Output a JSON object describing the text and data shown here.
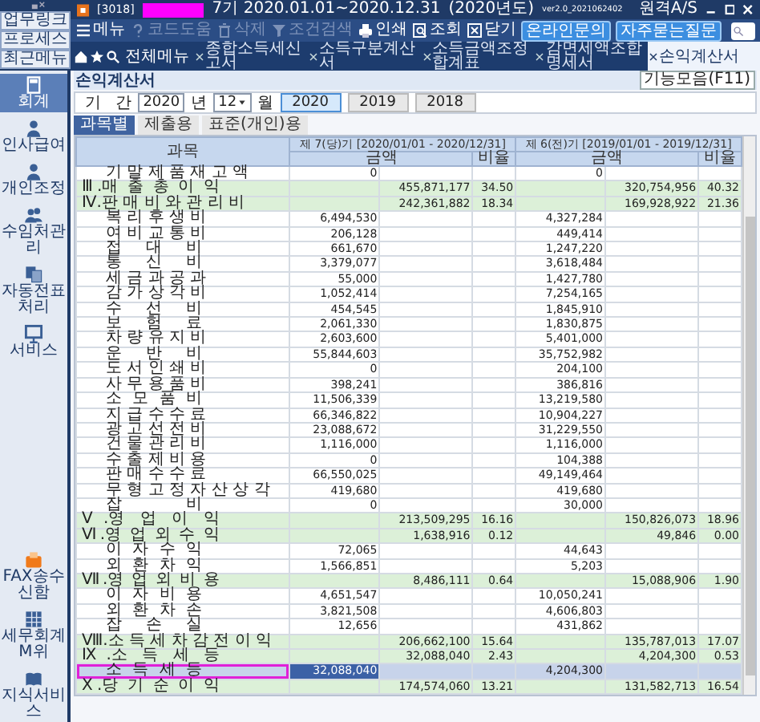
{
  "title_bar": {
    "company_code": "[3018]",
    "period": "7기 2020.01.01~2020.12.31",
    "fiscal_year": "(2020년도)",
    "version": "ver2.0_2021062402",
    "remote_support": "원격A/S"
  },
  "quick_links": [
    {
      "label": "업무링크"
    },
    {
      "label": "프로세스"
    },
    {
      "label": "최근메뉴"
    }
  ],
  "toolbar": [
    {
      "kind": "menu",
      "label": "메뉴",
      "disabled": false
    },
    {
      "kind": "help",
      "label": "코드도움",
      "disabled": true
    },
    {
      "kind": "delete",
      "label": "삭제",
      "disabled": true
    },
    {
      "kind": "filter",
      "label": "조건검색",
      "disabled": true
    },
    {
      "kind": "print",
      "label": "인쇄",
      "disabled": false
    },
    {
      "kind": "search",
      "label": "조회",
      "disabled": false
    },
    {
      "kind": "close",
      "label": "닫기",
      "disabled": false
    },
    {
      "kind": "pill",
      "label": "온라인문의",
      "disabled": false
    },
    {
      "kind": "pill",
      "label": "자주묻는질문",
      "disabled": false
    }
  ],
  "nav_tabs": {
    "all_menu": "전체메뉴",
    "tabs": [
      {
        "label": "종합소득세신고서",
        "selected": false
      },
      {
        "label": "소득구분계산서",
        "selected": false
      },
      {
        "label": "소득금액조정합계표",
        "selected": false
      },
      {
        "label": "감면세액조합명세서",
        "selected": false
      },
      {
        "label": "손익계산서",
        "selected": true
      }
    ]
  },
  "sidebar": {
    "items": [
      {
        "kind": "calculator",
        "label": "회계",
        "selected": true
      },
      {
        "kind": "person",
        "label": "인사급여",
        "selected": false
      },
      {
        "kind": "person",
        "label": "개인조정",
        "selected": false
      },
      {
        "kind": "people",
        "label": "수임처관리",
        "selected": false
      },
      {
        "kind": "docs",
        "label": "자동전표처리",
        "selected": false
      },
      {
        "kind": "monitor",
        "label": "서비스",
        "selected": false
      }
    ],
    "bottom_items": [
      {
        "kind": "fax",
        "label": "FAX송수신함"
      },
      {
        "kind": "grid",
        "label": "세무회계M위"
      },
      {
        "kind": "book",
        "label": "지식서비스"
      }
    ]
  },
  "page": {
    "title": "손익계산서",
    "functions_button": "기능모음(F11)"
  },
  "period": {
    "label": "기 간",
    "year": "2020",
    "year_unit": "년",
    "month": "12",
    "month_unit": "월",
    "year_buttons": [
      {
        "label": "2020",
        "selected": true
      },
      {
        "label": "2019",
        "selected": false
      },
      {
        "label": "2018",
        "selected": false
      }
    ]
  },
  "view_tabs": [
    {
      "label": "과목별",
      "selected": true
    },
    {
      "label": "제출용",
      "selected": false
    },
    {
      "label": "표준(개인)용",
      "selected": false
    }
  ],
  "table": {
    "subject_header": "과목",
    "current_header": "제 7(당)기 [2020/01/01 - 2020/12/31]",
    "previous_header": "제 6(전)기 [2019/01/01 - 2019/12/31]",
    "current_amount_header": "금액",
    "current_ratio_header": "비율",
    "previous_amount_header": "금액",
    "previous_ratio_header": "비율",
    "rows": [
      {
        "label": "기 말 제 품 재 고 액",
        "kind": "item",
        "selected": false,
        "cur_detail": "0",
        "prev_detail": "0"
      },
      {
        "label": "Ⅲ.매 출 총 이 익",
        "kind": "total",
        "selected": false,
        "cur_total": "455,871,177",
        "cur_ratio": "34.50",
        "prev_total": "320,754,956",
        "prev_ratio": "40.32"
      },
      {
        "label": "Ⅳ.판 매 비 와 관 리 비",
        "kind": "total",
        "selected": false,
        "cur_total": "242,361,882",
        "cur_ratio": "18.34",
        "prev_total": "169,928,922",
        "prev_ratio": "21.36"
      },
      {
        "label": "복 리 후 생 비",
        "kind": "item",
        "selected": false,
        "cur_detail": "6,494,530",
        "prev_detail": "4,327,284"
      },
      {
        "label": "여 비 교 통 비",
        "kind": "item",
        "selected": false,
        "cur_detail": "206,128",
        "prev_detail": "449,414"
      },
      {
        "label": "접 대 비",
        "kind": "item",
        "selected": false,
        "cur_detail": "661,670",
        "prev_detail": "1,247,220"
      },
      {
        "label": "통 신 비",
        "kind": "item",
        "selected": false,
        "cur_detail": "3,379,077",
        "prev_detail": "3,618,484"
      },
      {
        "label": "세 금 과 공 과",
        "kind": "item",
        "selected": false,
        "cur_detail": "55,000",
        "prev_detail": "1,427,780"
      },
      {
        "label": "감 가 상 각 비",
        "kind": "item",
        "selected": false,
        "cur_detail": "1,052,414",
        "prev_detail": "7,254,165"
      },
      {
        "label": "수 선 비",
        "kind": "item",
        "selected": false,
        "cur_detail": "454,545",
        "prev_detail": "1,845,910"
      },
      {
        "label": "보 험 료",
        "kind": "item",
        "selected": false,
        "cur_detail": "2,061,330",
        "prev_detail": "1,830,875"
      },
      {
        "label": "차 량 유 지 비",
        "kind": "item",
        "selected": false,
        "cur_detail": "2,603,600",
        "prev_detail": "5,401,000"
      },
      {
        "label": "운 반 비",
        "kind": "item",
        "selected": false,
        "cur_detail": "55,844,603",
        "prev_detail": "35,752,982"
      },
      {
        "label": "도 서 인 쇄 비",
        "kind": "item",
        "selected": false,
        "cur_detail": "0",
        "prev_detail": "204,100"
      },
      {
        "label": "사 무 용 품 비",
        "kind": "item",
        "selected": false,
        "cur_detail": "398,241",
        "prev_detail": "386,816"
      },
      {
        "label": "소 모 품 비",
        "kind": "item",
        "selected": false,
        "cur_detail": "11,506,339",
        "prev_detail": "13,219,580"
      },
      {
        "label": "지 급 수 수 료",
        "kind": "item",
        "selected": false,
        "cur_detail": "66,346,822",
        "prev_detail": "10,904,227"
      },
      {
        "label": "광 고 선 전 비",
        "kind": "item",
        "selected": false,
        "cur_detail": "23,088,672",
        "prev_detail": "31,229,550"
      },
      {
        "label": "건 물 관 리 비",
        "kind": "item",
        "selected": false,
        "cur_detail": "1,116,000",
        "prev_detail": "1,116,000"
      },
      {
        "label": "수 출 제 비 용",
        "kind": "item",
        "selected": false,
        "cur_detail": "0",
        "prev_detail": "104,388"
      },
      {
        "label": "판 매 수 수 료",
        "kind": "item",
        "selected": false,
        "cur_detail": "66,550,025",
        "prev_detail": "49,149,464"
      },
      {
        "label": "무 형 고 정 자 산 상 각",
        "kind": "item",
        "selected": false,
        "cur_detail": "419,680",
        "prev_detail": "419,680"
      },
      {
        "label": "잡 비",
        "kind": "item",
        "selected": false,
        "cur_detail": "0",
        "prev_detail": "30,000"
      },
      {
        "label": "Ⅴ.영 업 이 익",
        "kind": "total",
        "selected": false,
        "cur_total": "213,509,295",
        "cur_ratio": "16.16",
        "prev_total": "150,826,073",
        "prev_ratio": "18.96"
      },
      {
        "label": "Ⅵ.영 업 외 수 익",
        "kind": "total",
        "selected": false,
        "cur_total": "1,638,916",
        "cur_ratio": "0.12",
        "prev_total": "49,846",
        "prev_ratio": "0.00"
      },
      {
        "label": "이 자 수 익",
        "kind": "item",
        "selected": false,
        "cur_detail": "72,065",
        "prev_detail": "44,643"
      },
      {
        "label": "외 환 차 익",
        "kind": "item",
        "selected": false,
        "cur_detail": "1,566,851",
        "prev_detail": "5,203"
      },
      {
        "label": "Ⅶ.영 업 외 비 용",
        "kind": "total",
        "selected": false,
        "cur_total": "8,486,111",
        "cur_ratio": "0.64",
        "prev_total": "15,088,906",
        "prev_ratio": "1.90"
      },
      {
        "label": "이 자 비 용",
        "kind": "item",
        "selected": false,
        "cur_detail": "4,651,547",
        "prev_detail": "10,050,241"
      },
      {
        "label": "외 환 차 손",
        "kind": "item",
        "selected": false,
        "cur_detail": "3,821,508",
        "prev_detail": "4,606,803"
      },
      {
        "label": "잡 손 실",
        "kind": "item",
        "selected": false,
        "cur_detail": "12,656",
        "prev_detail": "431,862"
      },
      {
        "label": "Ⅷ.소 득 세 차 감 전 이 익",
        "kind": "total",
        "selected": false,
        "cur_total": "206,662,100",
        "cur_ratio": "15.64",
        "prev_total": "135,787,013",
        "prev_ratio": "17.07"
      },
      {
        "label": "Ⅸ.소 득 세 등",
        "kind": "total",
        "selected": false,
        "cur_total": "32,088,040",
        "cur_ratio": "2.43",
        "prev_total": "4,204,300",
        "prev_ratio": "0.53"
      },
      {
        "label": "소 득 세 등",
        "kind": "item",
        "selected": true,
        "cur_detail": "32,088,040",
        "prev_detail": "4,204,300"
      },
      {
        "label": "Ⅹ.당 기 순 이 익",
        "kind": "total",
        "selected": false,
        "cur_total": "174,574,060",
        "cur_ratio": "13.21",
        "prev_total": "131,582,713",
        "prev_ratio": "16.54"
      }
    ]
  }
}
